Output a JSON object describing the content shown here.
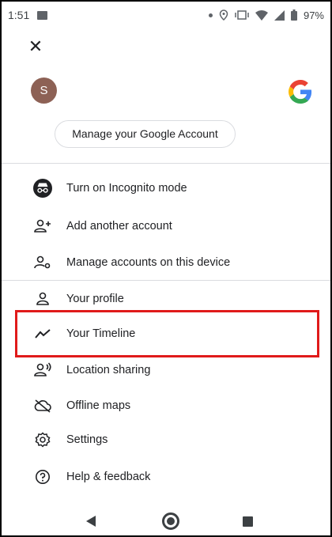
{
  "status_bar": {
    "time": "1:51",
    "battery": "97%"
  },
  "account": {
    "avatar_initial": "S",
    "manage_label": "Manage your Google Account"
  },
  "menu": {
    "items": [
      {
        "label": "Turn on Incognito mode",
        "icon": "incognito-icon"
      },
      {
        "label": "Add another account",
        "icon": "add-person-icon"
      },
      {
        "label": "Manage accounts on this device",
        "icon": "manage-accounts-icon"
      },
      {
        "label": "Your profile",
        "icon": "person-icon"
      },
      {
        "label": "Your Timeline",
        "icon": "timeline-icon"
      },
      {
        "label": "Location sharing",
        "icon": "location-sharing-icon"
      },
      {
        "label": "Offline maps",
        "icon": "offline-maps-icon"
      },
      {
        "label": "Settings",
        "icon": "gear-icon"
      },
      {
        "label": "Help & feedback",
        "icon": "help-icon"
      }
    ]
  },
  "colors": {
    "highlight": "#e01a1a",
    "avatar_bg": "#8d6155",
    "divider": "#dadce0"
  }
}
